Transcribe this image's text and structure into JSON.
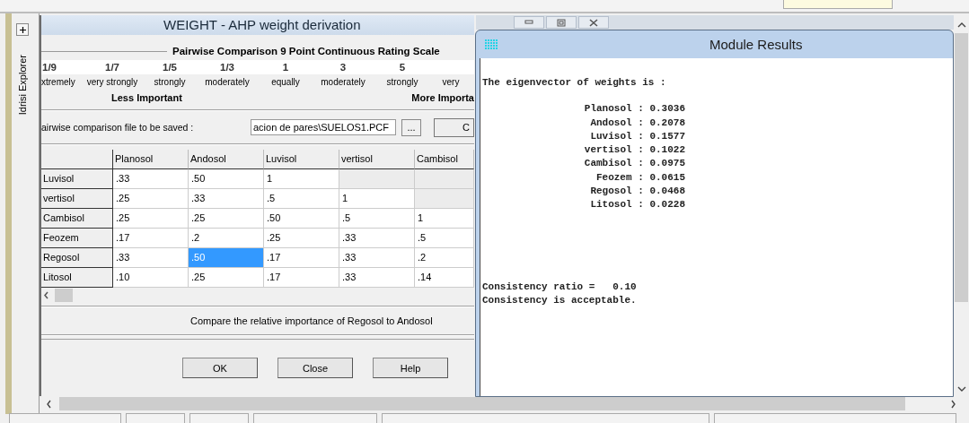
{
  "sidebar": {
    "title": "Idrisi Explorer"
  },
  "weight_window": {
    "title": "WEIGHT - AHP weight derivation",
    "scale_title": "Pairwise Comparison 9 Point Continuous Rating Scale",
    "scale": [
      {
        "value": "1/9",
        "label": "xtremely"
      },
      {
        "value": "1/7",
        "label": "very strongly"
      },
      {
        "value": "1/5",
        "label": "strongly"
      },
      {
        "value": "1/3",
        "label": "moderately"
      },
      {
        "value": "1",
        "label": "equally"
      },
      {
        "value": "3",
        "label": "moderately"
      },
      {
        "value": "5",
        "label": "strongly"
      },
      {
        "label": "very"
      }
    ],
    "less_label": "Less Important",
    "more_label": "More Importa",
    "file_label": "airwise comparison file to be saved :",
    "file_value": "acion de pares\\SUELOS1.PCF",
    "browse_button": "...",
    "cut_button": "C",
    "table": {
      "columns": [
        "Planosol",
        "Andosol",
        "Luvisol",
        "vertisol",
        "Cambisol"
      ],
      "rows": [
        {
          "name": "Luvisol",
          "cells": [
            {
              "text": ".33",
              "selected": false
            },
            {
              "text": ".50",
              "selected": false
            },
            {
              "text": "1",
              "selected": false
            },
            {
              "selected": false
            },
            {
              "selected": false
            }
          ]
        },
        {
          "name": "vertisol",
          "cells": [
            {
              "text": ".25",
              "selected": false
            },
            {
              "text": ".33",
              "selected": false
            },
            {
              "text": ".5",
              "selected": false
            },
            {
              "text": "1",
              "selected": false
            },
            {
              "selected": false
            }
          ]
        },
        {
          "name": "Cambisol",
          "cells": [
            {
              "text": ".25",
              "selected": false
            },
            {
              "text": ".25",
              "selected": false
            },
            {
              "text": ".50",
              "selected": false
            },
            {
              "text": ".5",
              "selected": false
            },
            {
              "text": "1",
              "selected": false
            }
          ]
        },
        {
          "name": "Feozem",
          "cells": [
            {
              "text": ".17",
              "selected": false
            },
            {
              "text": ".2",
              "selected": false
            },
            {
              "text": ".25",
              "selected": false
            },
            {
              "text": ".33",
              "selected": false
            },
            {
              "text": ".5",
              "selected": false
            }
          ]
        },
        {
          "name": "Regosol",
          "cells": [
            {
              "text": ".33",
              "selected": false
            },
            {
              "text": ".50",
              "selected": true
            },
            {
              "text": ".17",
              "selected": false
            },
            {
              "text": ".33",
              "selected": false
            },
            {
              "text": ".2",
              "selected": false
            }
          ]
        },
        {
          "name": "Litosol",
          "cells": [
            {
              "text": ".10",
              "selected": false
            },
            {
              "text": ".25",
              "selected": false
            },
            {
              "text": ".17",
              "selected": false
            },
            {
              "text": ".33",
              "selected": false
            },
            {
              "text": ".14",
              "selected": false
            }
          ]
        }
      ]
    },
    "prompt": "Compare the relative importance of Regosol to Andosol",
    "buttons": [
      "OK",
      "Close",
      "Help"
    ]
  },
  "results_window": {
    "title": "Module Results",
    "heading": "The eigenvector of weights is :",
    "weights": [
      "Planosol : 0.3036",
      "Andosol : 0.2078",
      "Luvisol : 0.1577",
      "vertisol : 0.1022",
      "Cambisol : 0.0975",
      "Feozem : 0.0615",
      "Regosol : 0.0468",
      "Litosol : 0.0228"
    ],
    "consistency_ratio": "Consistency ratio =   0.10",
    "consistency_note": "Consistency is acceptable."
  }
}
